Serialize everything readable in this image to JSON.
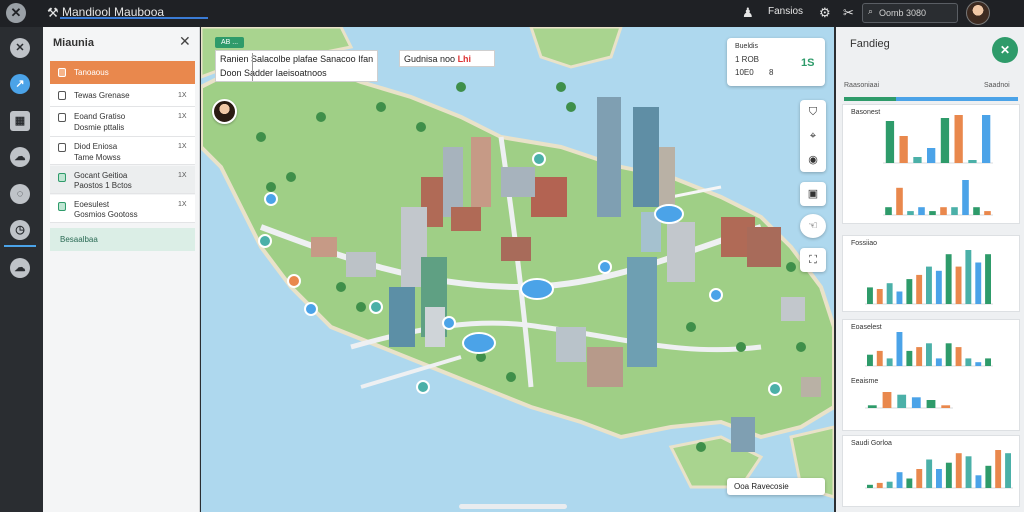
{
  "topbar": {
    "app_title": "Mandiool Maubooa",
    "right_label": "Fansios",
    "search_placeholder": "Oomb 3080"
  },
  "sidebar": {
    "title": "Miaunia",
    "items": [
      {
        "label": "Tanoaous",
        "active": true
      },
      {
        "label": "Tewas Grenase",
        "badge": "1X"
      },
      {
        "label": "Eoand Gratiso",
        "sub": "Dosmie pttalis",
        "badge": "1X"
      },
      {
        "label": "Diod Eniosa",
        "sub": "Tame Mowss",
        "badge": "1X"
      },
      {
        "label": "Gocant Geitioa",
        "sub": "Paostos 1 Bctos",
        "badge": "1X"
      },
      {
        "label": "Eoesulest",
        "sub": "Gosmios Gootoss",
        "badge": "1X"
      }
    ],
    "footer_label": "Besaalbaa"
  },
  "map": {
    "top_tag": "AB ...",
    "card_row1": "Ranien   Salacolbe plafae   Sanacoo Ifan",
    "card_row2": "Doon     Sadder Iaeisoatnoos",
    "card2_text": "Gudnisa noo",
    "card2_red": "Lhi",
    "stats": {
      "title": "Bueldis",
      "a": "1 ROB",
      "b": "10E0",
      "c": "8",
      "big": "1S"
    },
    "footer": "Ooa Ravecosie"
  },
  "right_panel": {
    "title": "Fandieg",
    "subtitle": "Raasoniaai",
    "subtitle_right": "Saadnoi",
    "colors": {
      "green": "#2e9b6a",
      "orange": "#e9884d",
      "teal": "#4bb0a8",
      "blue": "#4ba3e8"
    }
  },
  "chart_data": [
    {
      "type": "bar",
      "title": "Basonest",
      "series": [
        {
          "values": [
            70,
            45,
            10,
            25,
            75,
            80,
            5,
            80
          ]
        }
      ]
    },
    {
      "type": "bar",
      "title": "",
      "series": [
        {
          "values": [
            10,
            35,
            5,
            10,
            5,
            10,
            10,
            45,
            10,
            5
          ]
        }
      ]
    },
    {
      "type": "bar",
      "title": "Fossiiao",
      "series": [
        {
          "values": [
            20,
            18,
            25,
            15,
            30,
            35,
            45,
            40,
            60,
            45,
            65,
            50,
            60
          ]
        }
      ]
    },
    {
      "type": "bar",
      "title": "Eoaselest",
      "series": [
        {
          "values": [
            15,
            20,
            10,
            45,
            20,
            25,
            30,
            10,
            30,
            25,
            10,
            5,
            10
          ]
        }
      ]
    },
    {
      "type": "bar",
      "title": "Eeaisme",
      "series": [
        {
          "values": [
            5,
            30,
            25,
            20,
            15,
            5
          ]
        }
      ]
    },
    {
      "type": "bar",
      "title": "Saudi Gorloa",
      "series": [
        {
          "values": [
            5,
            8,
            10,
            25,
            15,
            30,
            45,
            30,
            40,
            55,
            50,
            20,
            35,
            60,
            55
          ]
        }
      ]
    }
  ]
}
